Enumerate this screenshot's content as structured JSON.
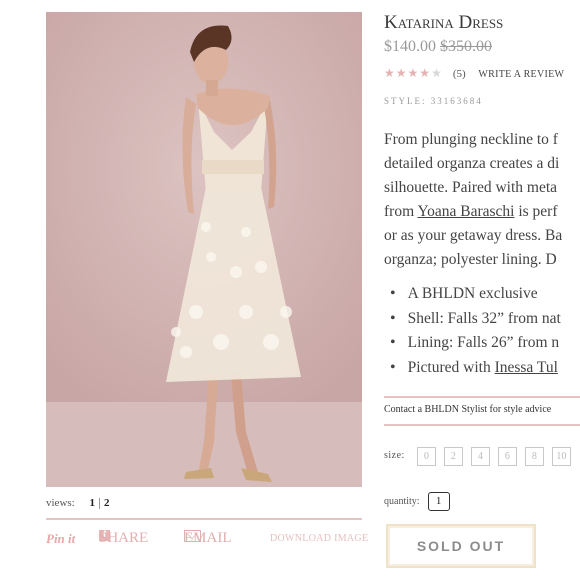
{
  "product": {
    "title": "Katarina Dress",
    "price": "$140.00",
    "was_price": "$350.00",
    "rating_stars": 4,
    "review_count": "(5)",
    "write_review": "WRITE A REVIEW",
    "style_line": "STYLE: 33163684"
  },
  "description": {
    "lines": [
      "From plunging neckline to f",
      "detailed organza creates a di",
      "silhouette. Paired with meta",
      "from",
      "is perf",
      "or as your getaway dress. Ba",
      "organza; polyester lining. D"
    ],
    "designer_link": "Yoana Baraschi"
  },
  "bullets": [
    "A BHLDN exclusive",
    "Shell: Falls 32” from nat",
    "Lining: Falls 26” from n",
    "Pictured with"
  ],
  "bullet_link": "Inessa Tul",
  "contact": "Contact a BHLDN Stylist for style advice",
  "size": {
    "label": "size:",
    "options": [
      "0",
      "2",
      "4",
      "6",
      "8",
      "10"
    ]
  },
  "quantity": {
    "label": "quantity:",
    "value": "1"
  },
  "soldout_label": "SOLD OUT",
  "gallery": {
    "views_label": "views:",
    "pages": [
      "1",
      "2"
    ]
  },
  "share": {
    "pinit": "Pin it",
    "share": "SHARE",
    "email": "EMAIL",
    "download": "DOWNLOAD IMAGE"
  },
  "colors": {
    "accent_pink": "#e6c3c3",
    "star": "#e4b2b2"
  }
}
